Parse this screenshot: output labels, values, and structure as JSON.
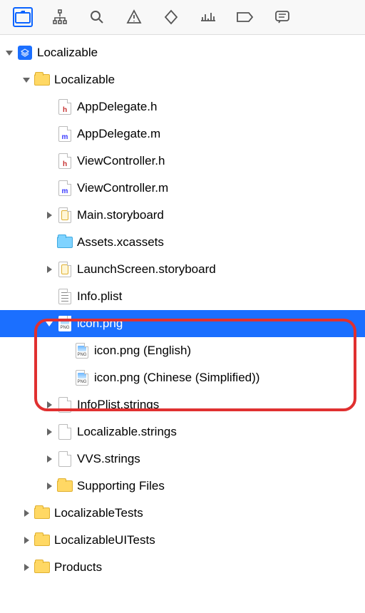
{
  "toolbar": {
    "tabs": [
      {
        "name": "project-navigator",
        "selected": true
      },
      {
        "name": "source-control-navigator"
      },
      {
        "name": "find-navigator"
      },
      {
        "name": "issue-navigator"
      },
      {
        "name": "test-navigator"
      },
      {
        "name": "debug-navigator"
      },
      {
        "name": "breakpoint-navigator"
      },
      {
        "name": "report-navigator"
      }
    ]
  },
  "tree": {
    "root": {
      "label": "Localizable",
      "expanded": true,
      "children": [
        {
          "type": "group",
          "label": "Localizable",
          "expanded": true,
          "children": [
            {
              "type": "file-h",
              "label": "AppDelegate.h"
            },
            {
              "type": "file-m",
              "label": "AppDelegate.m"
            },
            {
              "type": "file-h",
              "label": "ViewController.h"
            },
            {
              "type": "file-m",
              "label": "ViewController.m"
            },
            {
              "type": "storyboard",
              "label": "Main.storyboard",
              "expanded": false
            },
            {
              "type": "assets",
              "label": "Assets.xcassets"
            },
            {
              "type": "storyboard",
              "label": "LaunchScreen.storyboard",
              "expanded": false
            },
            {
              "type": "plist",
              "label": "Info.plist"
            },
            {
              "type": "png-group",
              "label": "icon.png",
              "expanded": true,
              "selected": true,
              "children": [
                {
                  "type": "png",
                  "label": "icon.png (English)"
                },
                {
                  "type": "png",
                  "label": "icon.png (Chinese (Simplified))"
                }
              ]
            },
            {
              "type": "strings",
              "label": "InfoPlist.strings",
              "expanded": false
            },
            {
              "type": "strings",
              "label": "Localizable.strings",
              "expanded": false
            },
            {
              "type": "strings",
              "label": "VVS.strings",
              "expanded": false
            },
            {
              "type": "group",
              "label": "Supporting Files",
              "expanded": false
            }
          ]
        },
        {
          "type": "group",
          "label": "LocalizableTests",
          "expanded": false
        },
        {
          "type": "group",
          "label": "LocalizableUITests",
          "expanded": false
        },
        {
          "type": "group",
          "label": "Products",
          "expanded": false
        }
      ]
    }
  }
}
